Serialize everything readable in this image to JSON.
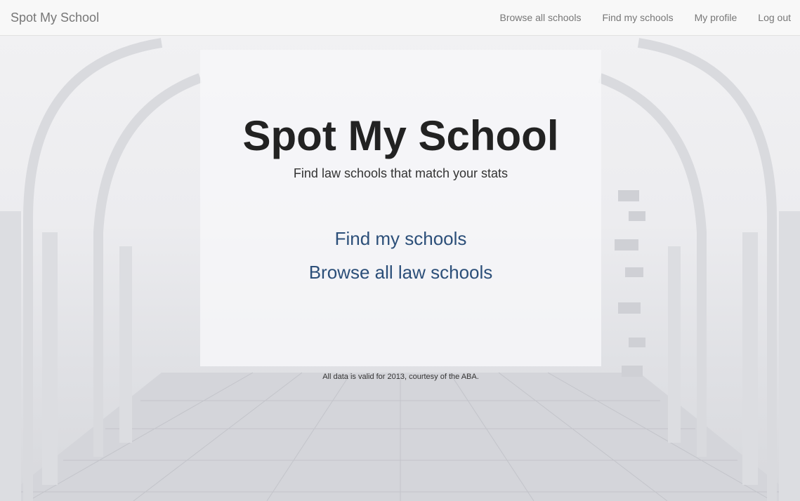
{
  "navbar": {
    "brand": "Spot My School",
    "links": [
      {
        "label": "Browse all schools"
      },
      {
        "label": "Find my schools"
      },
      {
        "label": "My profile"
      },
      {
        "label": "Log out"
      }
    ]
  },
  "hero": {
    "title": "Spot My School",
    "tagline": "Find law schools that match your stats",
    "cta_find": "Find my schools",
    "cta_browse": "Browse all law schools",
    "footer_note": "All data is valid for 2013, courtesy of the ABA."
  },
  "colors": {
    "nav_bg": "#f8f8f8",
    "nav_text": "#777777",
    "title_text": "#222222",
    "link_blue": "#2c4f79"
  }
}
